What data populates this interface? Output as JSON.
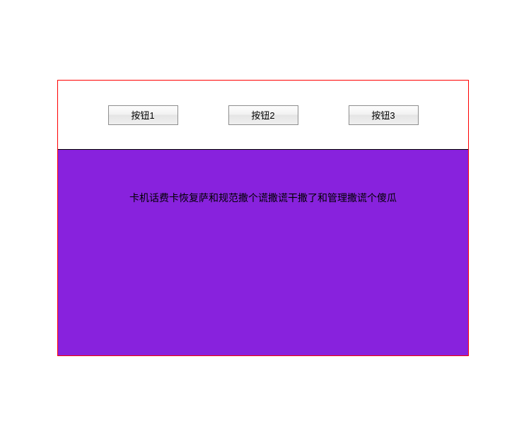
{
  "buttons": {
    "btn1": "按钮1",
    "btn2": "按钮2",
    "btn3": "按钮3"
  },
  "panel": {
    "text": "卡机话费卡恢复萨和规范撒个谎撒谎干撒了和管理撒谎个傻瓜"
  },
  "colors": {
    "border": "#ff0000",
    "panel_bg": "#8822dd"
  }
}
